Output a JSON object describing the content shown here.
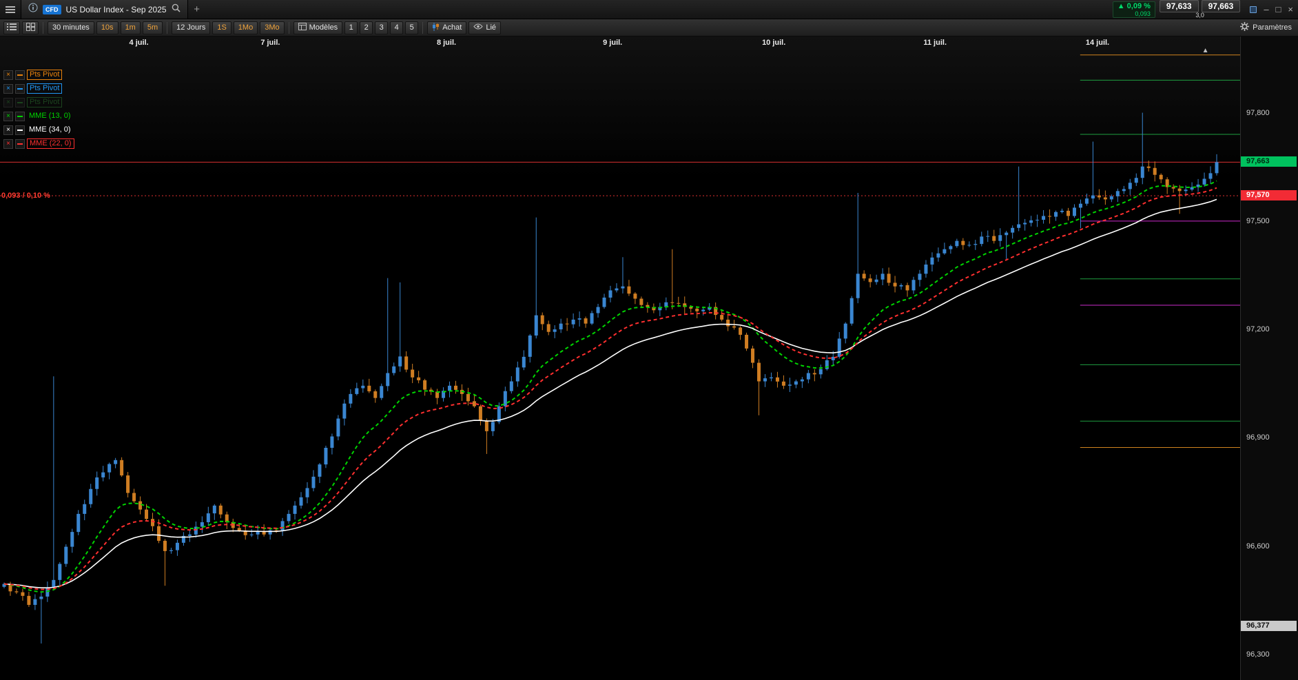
{
  "topbar": {
    "instrument_badge": "CFD",
    "title": "US Dollar Index - Sep 2025",
    "new_tab": "+",
    "change_arrow": "▲",
    "change_pct": "0,09 %",
    "change_abs": "0,093",
    "bid": "97,633",
    "ask": "97,663",
    "spread": "3,0"
  },
  "window": {
    "minimize": "–",
    "maximize": "□",
    "close": "×"
  },
  "toolbar": {
    "timeframe_current": "30 minutes",
    "quick_timeframes": [
      "10s",
      "1m",
      "5m"
    ],
    "range_current": "12 Jours",
    "quick_ranges": [
      "1S",
      "1Mo",
      "3Mo"
    ],
    "templates_label": "Modèles",
    "template_slots": [
      "1",
      "2",
      "3",
      "4",
      "5"
    ],
    "buy_label": "Achat",
    "linked_label": "Lié",
    "settings_label": "Paramètres"
  },
  "legend": [
    {
      "label": "Pts Pivot",
      "color": "#e8820c",
      "boxed": true,
      "dim": false
    },
    {
      "label": "Pts Pivot",
      "color": "#2196f3",
      "boxed": true,
      "dim": false
    },
    {
      "label": "Pts Pivot",
      "color": "#2e7d32",
      "boxed": true,
      "dim": true
    },
    {
      "label": "MME (13, 0)",
      "color": "#00d400",
      "boxed": false,
      "dim": false
    },
    {
      "label": "MME (34, 0)",
      "color": "#ffffff",
      "boxed": false,
      "dim": false
    },
    {
      "label": "MME (22, 0)",
      "color": "#ff2f2f",
      "boxed": true,
      "dim": false
    }
  ],
  "chart_data": {
    "type": "candlestick",
    "instrument": "US Dollar Index - Sep 2025",
    "timeframe": "30 minutes",
    "date_labels": [
      {
        "label": "4 juil.",
        "x": 0.112
      },
      {
        "label": "7 juil.",
        "x": 0.218
      },
      {
        "label": "8 juil.",
        "x": 0.36
      },
      {
        "label": "9 juil.",
        "x": 0.494
      },
      {
        "label": "10 juil.",
        "x": 0.624
      },
      {
        "label": "11 juil.",
        "x": 0.754
      },
      {
        "label": "14 juil.",
        "x": 0.885
      }
    ],
    "price_axis": {
      "min": 96229,
      "max": 98011,
      "ticks": [
        {
          "label": "97,800",
          "price": 97800
        },
        {
          "label": "97,500",
          "price": 97500
        },
        {
          "label": "97,200",
          "price": 97200
        },
        {
          "label": "96,900",
          "price": 96900
        },
        {
          "label": "96,600",
          "price": 96600
        },
        {
          "label": "96,300",
          "price": 96300
        }
      ],
      "badges": [
        {
          "label": "97,663",
          "price": 97663,
          "bg": "#00c25e",
          "fg": "#002912"
        },
        {
          "label": "97,570",
          "price": 97570,
          "bg": "#f22b35",
          "fg": "#ffffff"
        },
        {
          "label": "96,377",
          "price": 96377,
          "bg": "#c9c9c9",
          "fg": "#101010"
        }
      ]
    },
    "closes": [
      96495,
      96472,
      96437,
      96460,
      96506,
      96598,
      96689,
      96758,
      96804,
      96838,
      96747,
      96701,
      96655,
      96586,
      96609,
      96632,
      96666,
      96712,
      96666,
      96643,
      96632,
      96632,
      96643,
      96689,
      96735,
      96792,
      96872,
      96953,
      97021,
      97044,
      97010,
      97079,
      97125,
      97067,
      97033,
      97010,
      97044,
      97021,
      96987,
      96918,
      96987,
      97056,
      97124,
      97239,
      97193,
      97216,
      97227,
      97216,
      97262,
      97308,
      97319,
      97285,
      97262,
      97262,
      97273,
      97262,
      97250,
      97262,
      97227,
      97205,
      97147,
      97056,
      97067,
      97044,
      97056,
      97079,
      97090,
      97124,
      97216,
      97354,
      97331,
      97354,
      97319,
      97308,
      97354,
      97399,
      97422,
      97445,
      97434,
      97457,
      97445,
      97468,
      97491,
      97502,
      97514,
      97525,
      97514,
      97548,
      97571,
      97560,
      97583,
      97606,
      97651,
      97628,
      97594,
      97583,
      97594,
      97617,
      97663
    ],
    "wick_highs": [
      {
        "i": 4,
        "price": 97070
      },
      {
        "i": 31,
        "price": 97342
      },
      {
        "i": 32,
        "price": 97330
      },
      {
        "i": 43,
        "price": 97510
      },
      {
        "i": 50,
        "price": 97400
      },
      {
        "i": 54,
        "price": 97422
      },
      {
        "i": 69,
        "price": 97578
      },
      {
        "i": 82,
        "price": 97651
      },
      {
        "i": 88,
        "price": 97720
      },
      {
        "i": 92,
        "price": 97800
      },
      {
        "i": 98,
        "price": 97685
      }
    ],
    "wick_lows": [
      {
        "i": 3,
        "price": 96330
      },
      {
        "i": 13,
        "price": 96490
      },
      {
        "i": 39,
        "price": 96855
      },
      {
        "i": 61,
        "price": 96962
      },
      {
        "i": 81,
        "price": 97395
      },
      {
        "i": 87,
        "price": 97480
      },
      {
        "i": 95,
        "price": 97520
      }
    ],
    "levels_full": [
      {
        "price": 97663,
        "color": "#d93030",
        "style": "solid"
      },
      {
        "price": 97570,
        "color": "#e03131",
        "style": "dotted",
        "label": "0,093 / 0,10 %"
      }
    ],
    "levels_right": [
      {
        "price": 97960,
        "color": "#d0831f",
        "x0": 0.871
      },
      {
        "price": 97890,
        "color": "#1e9e40",
        "x0": 0.871
      },
      {
        "price": 97740,
        "color": "#1e9e40",
        "x0": 0.871
      },
      {
        "price": 97500,
        "color": "#cc2bcc",
        "x0": 0.871
      },
      {
        "price": 97340,
        "color": "#1e9e40",
        "x0": 0.871
      },
      {
        "price": 97267,
        "color": "#cc2bcc",
        "x0": 0.871
      },
      {
        "price": 97102,
        "color": "#1e9e40",
        "x0": 0.871
      },
      {
        "price": 96946,
        "color": "#1e9e40",
        "x0": 0.871
      },
      {
        "price": 96873,
        "color": "#d0831f",
        "x0": 0.871
      }
    ],
    "marker": {
      "glyph": "▲",
      "price": 97960,
      "x": 0.972
    },
    "emas": [
      {
        "period": 13,
        "color": "#00d400",
        "dash": "5 4"
      },
      {
        "period": 34,
        "color": "#ffffff",
        "dash": ""
      },
      {
        "period": 22,
        "color": "#ff2f2f",
        "dash": "5 4"
      }
    ],
    "colors": {
      "up": "#3a86d1",
      "down": "#cf7d22"
    },
    "left_label": "0,093 / 0,10 %"
  }
}
